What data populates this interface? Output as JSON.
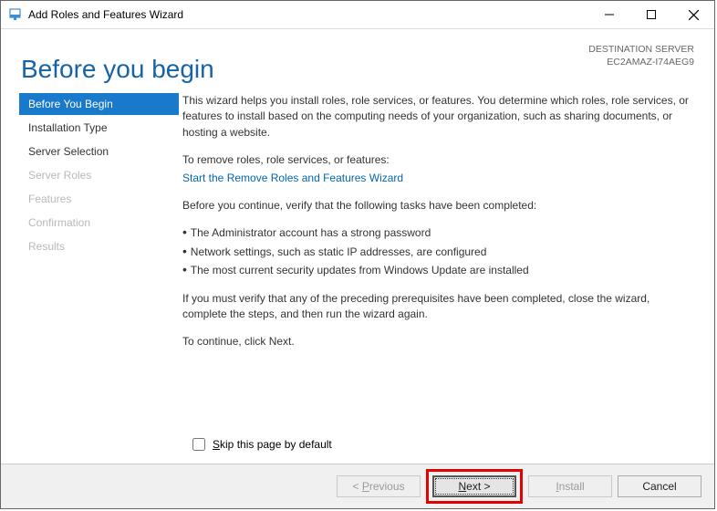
{
  "titlebar": {
    "title": "Add Roles and Features Wizard"
  },
  "header": {
    "page_title": "Before you begin",
    "server_label": "DESTINATION SERVER",
    "server_name": "EC2AMAZ-I74AEG9"
  },
  "sidebar": {
    "items": [
      {
        "label": "Before You Begin",
        "state": "active"
      },
      {
        "label": "Installation Type",
        "state": "enabled"
      },
      {
        "label": "Server Selection",
        "state": "enabled"
      },
      {
        "label": "Server Roles",
        "state": "disabled"
      },
      {
        "label": "Features",
        "state": "disabled"
      },
      {
        "label": "Confirmation",
        "state": "disabled"
      },
      {
        "label": "Results",
        "state": "disabled"
      }
    ]
  },
  "content": {
    "intro": "This wizard helps you install roles, role services, or features. You determine which roles, role services, or features to install based on the computing needs of your organization, such as sharing documents, or hosting a website.",
    "remove_label": "To remove roles, role services, or features:",
    "remove_link": "Start the Remove Roles and Features Wizard",
    "verify_label": "Before you continue, verify that the following tasks have been completed:",
    "bullets": [
      "The Administrator account has a strong password",
      "Network settings, such as static IP addresses, are configured",
      "The most current security updates from Windows Update are installed"
    ],
    "must_verify": "If you must verify that any of the preceding prerequisites have been completed, close the wizard, complete the steps, and then run the wizard again.",
    "continue": "To continue, click Next."
  },
  "skip": {
    "label_pre": "S",
    "label_rest": "kip this page by default"
  },
  "footer": {
    "previous": "< Previous",
    "next": "Next >",
    "install": "Install",
    "cancel": "Cancel"
  }
}
